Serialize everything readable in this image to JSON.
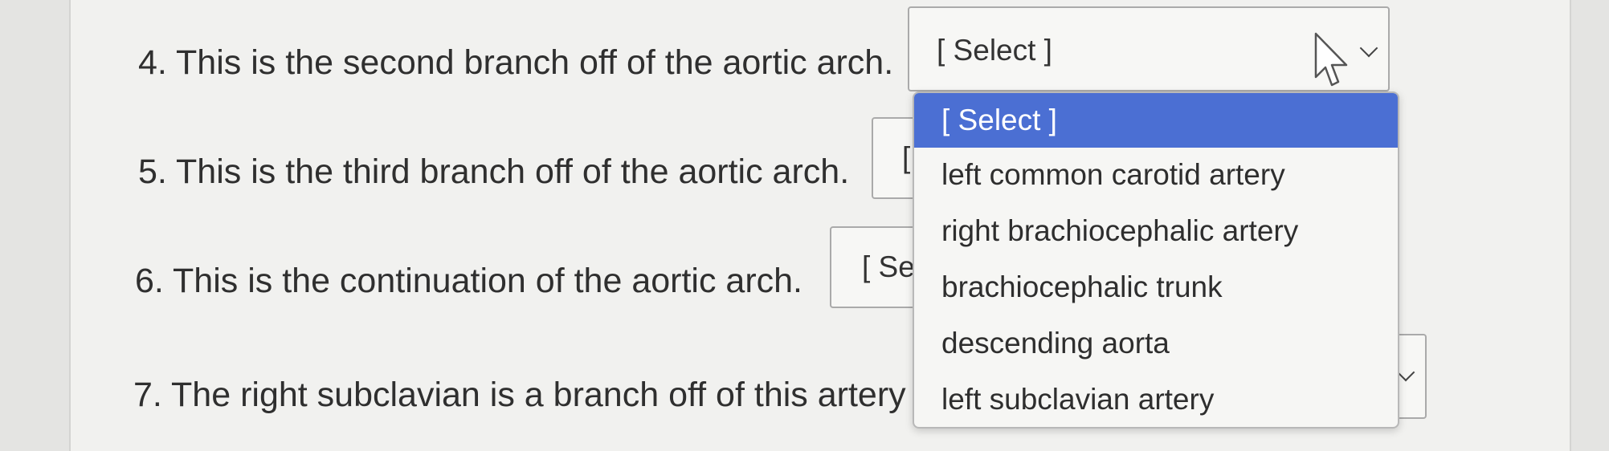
{
  "questions": [
    {
      "text": "4. This is the second branch off of the aortic arch.",
      "select_value": "[ Select ]"
    },
    {
      "text": "5. This is the third branch off of the aortic arch.",
      "select_value": "["
    },
    {
      "text": "6. This is the continuation of the aortic arch.",
      "select_value": "[ Se"
    },
    {
      "text": "7. The right subclavian is a branch off of this artery",
      "select_value": ""
    }
  ],
  "dropdown": {
    "options": [
      "[ Select ]",
      "left common carotid artery",
      "right brachiocephalic artery",
      "brachiocephalic trunk",
      "descending aorta",
      "left subclavian artery"
    ],
    "highlighted_index": 0
  },
  "colors": {
    "highlight": "#4b6fd3",
    "page_background": "#f1f1ef"
  },
  "icons": [
    "chevron-down-icon",
    "mouse-pointer-icon"
  ]
}
